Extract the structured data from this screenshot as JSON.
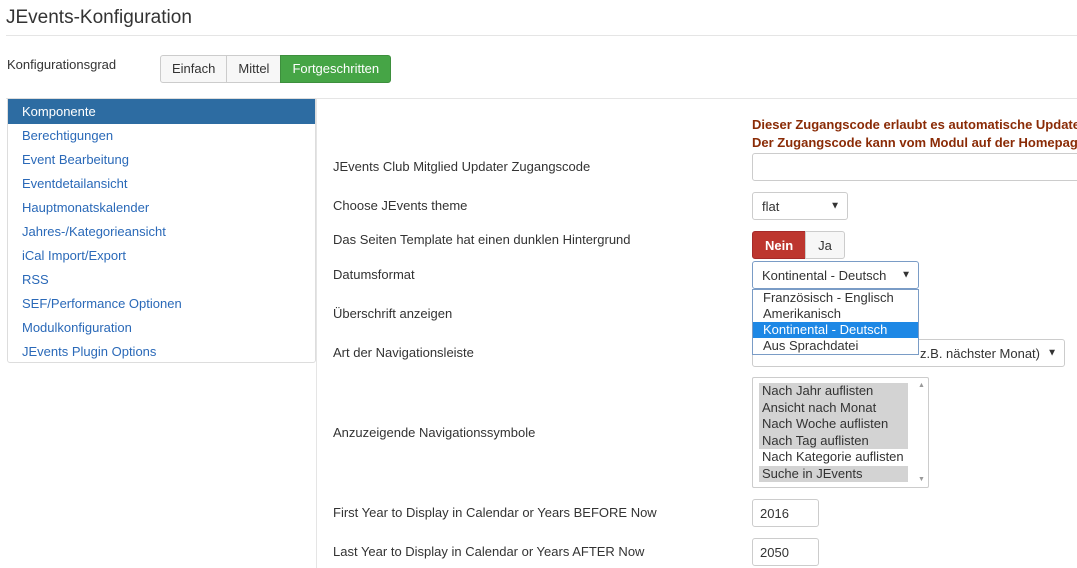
{
  "header": {
    "title": "JEvents-Konfiguration"
  },
  "config_level": {
    "label": "Konfigurationsgrad",
    "options": [
      "Einfach",
      "Mittel",
      "Fortgeschritten"
    ],
    "active": "Fortgeschritten"
  },
  "sidebar": {
    "items": [
      {
        "label": "Komponente",
        "active": true
      },
      {
        "label": "Berechtigungen"
      },
      {
        "label": "Event Bearbeitung"
      },
      {
        "label": "Eventdetailansicht"
      },
      {
        "label": "Hauptmonatskalender"
      },
      {
        "label": "Jahres-/Kategorieansicht"
      },
      {
        "label": "iCal Import/Export"
      },
      {
        "label": "RSS"
      },
      {
        "label": "SEF/Performance Optionen"
      },
      {
        "label": "Modulkonfiguration"
      },
      {
        "label": "JEvents Plugin Options"
      }
    ]
  },
  "notice": {
    "line1": "Dieser Zugangscode erlaubt es automatische Updates",
    "line2": "Der Zugangscode kann vom Modul auf der Homepage"
  },
  "fields": {
    "club_code": {
      "label": "JEvents Club Mitglied Updater Zugangscode",
      "value": ""
    },
    "theme": {
      "label": "Choose JEvents theme",
      "value": "flat"
    },
    "dark_bg": {
      "label": "Das Seiten Template hat einen dunklen Hintergrund",
      "no": "Nein",
      "yes": "Ja",
      "selected": "Nein"
    },
    "date_format": {
      "label": "Datumsformat",
      "value": "Kontinental - Deutsch",
      "options": [
        "Französisch - Englisch",
        "Amerikanisch",
        "Kontinental - Deutsch",
        "Aus Sprachdatei"
      ],
      "highlighted": "Kontinental - Deutsch"
    },
    "show_heading": {
      "label": "Überschrift anzeigen"
    },
    "nav_bar": {
      "label": "Art der Navigationsleiste",
      "value_visible": "z.B. nächster Monat)"
    },
    "nav_symbols": {
      "label": "Anzuzeigende Navigationssymbole",
      "options": [
        {
          "label": "Nach Jahr auflisten",
          "selected": true
        },
        {
          "label": "Ansicht nach Monat",
          "selected": true
        },
        {
          "label": "Nach Woche auflisten",
          "selected": true
        },
        {
          "label": "Nach Tag auflisten",
          "selected": true
        },
        {
          "label": "Nach Kategorie auflisten",
          "selected": false
        },
        {
          "label": "Suche in JEvents",
          "selected": true
        }
      ]
    },
    "first_year": {
      "label": "First Year to Display in Calendar or Years BEFORE Now",
      "value": "2016"
    },
    "last_year": {
      "label": "Last Year to Display in Calendar or Years AFTER Now",
      "value": "2050"
    }
  }
}
